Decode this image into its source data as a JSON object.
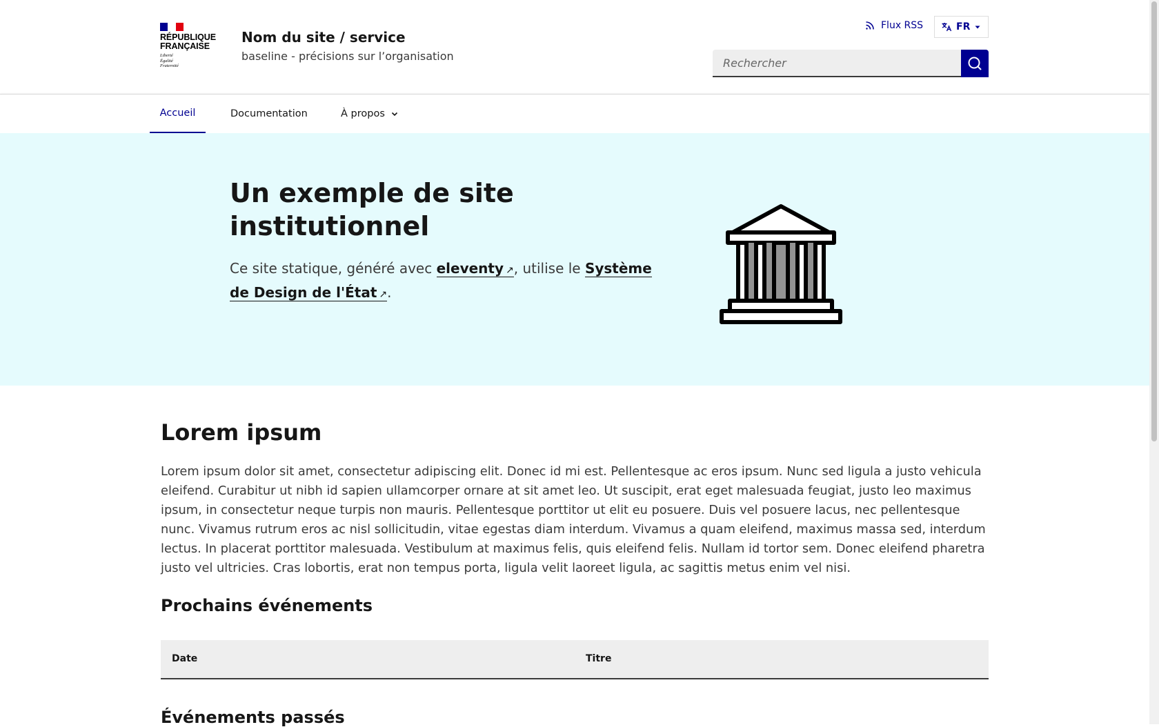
{
  "header": {
    "logo": {
      "line1": "RÉPUBLIQUE",
      "line2": "FRANÇAISE",
      "motto1": "Liberté",
      "motto2": "Égalité",
      "motto3": "Fraternité",
      "flag_colors": [
        "#000091",
        "#ffffff",
        "#e1000f"
      ]
    },
    "site_title": "Nom du site / service",
    "site_baseline": "baseline - précisions sur l’organisation",
    "rss_icon": "rss-icon",
    "rss_label": "Flux RSS",
    "lang_icon": "translate-icon",
    "lang_label": "FR",
    "search_placeholder": "Rechercher",
    "search_icon": "search-icon"
  },
  "nav": {
    "items": [
      {
        "label": "Accueil",
        "active": true
      },
      {
        "label": "Documentation",
        "active": false
      },
      {
        "label": "À propos",
        "active": false,
        "icon": "chevron-down-icon"
      }
    ]
  },
  "hero": {
    "title_line1": "Un exemple de site",
    "title_line2": "institutionnel",
    "text_before": "Ce site statique, généré avec ",
    "link1": "eleventy",
    "text_middle": ", utilise le ",
    "link2": "Système de Design de l'État",
    "text_after": ".",
    "external_icon": "external-link-icon",
    "illustration": "building-icon",
    "background": "#e5fbfd"
  },
  "main": {
    "heading": "Lorem ipsum",
    "paragraph": "Lorem ipsum dolor sit amet, consectetur adipiscing elit. Donec id mi est. Pellentesque ac eros ipsum. Nunc sed ligula a justo vehicula eleifend. Curabitur ut nibh id sapien ullamcorper ornare at sit amet leo. Ut suscipit, erat eget malesuada feugiat, justo leo maximus ipsum, in consectetur neque turpis non mauris. Pellentesque porttitor ut elit eu posuere. Duis vel posuere lacus, nec pellentesque nunc. Vivamus rutrum eros ac nisl sollicitudin, vitae egestas diam interdum. Vivamus a quam eleifend, maximus massa sed, interdum lectus. In placerat porttitor malesuada. Vestibulum at maximus felis, quis eleifend felis. Nullam id tortor sem. Donec eleifend pharetra justo vel ultricies. Cras lobortis, erat non tempus porta, ligula velit laoreet ligula, ac sagittis metus enim vel nisi.",
    "upcoming_heading": "Prochains événements",
    "table_headers": [
      "Date",
      "Titre"
    ],
    "past_heading": "Événements passés"
  },
  "colors": {
    "accent": "#000091",
    "text": "#161616",
    "text_secondary": "#3a3a3a"
  }
}
